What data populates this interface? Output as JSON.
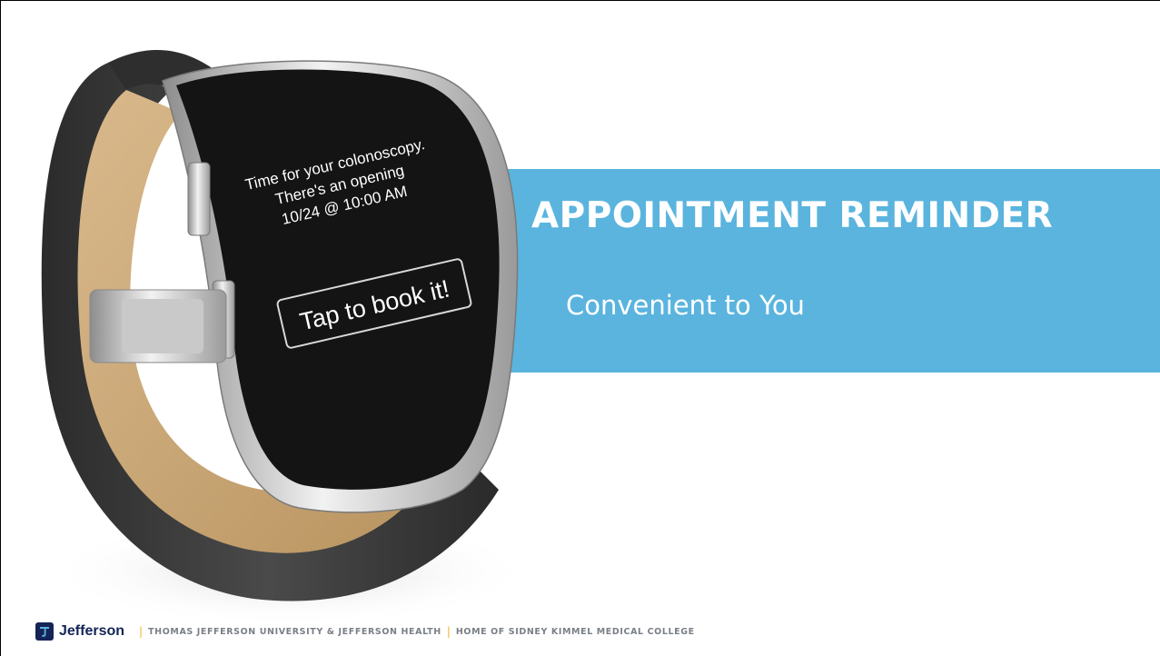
{
  "slide": {
    "title": "APPOINTMENT REMINDER",
    "subtitle": "Convenient to You"
  },
  "watch": {
    "message_line1": "Time for your colonoscopy.",
    "message_line2": "There's an opening",
    "message_line3": "10/24 @ 10:00 AM",
    "button_label": "Tap to book it!"
  },
  "footer": {
    "brand": "Jefferson",
    "org": "THOMAS JEFFERSON UNIVERSITY & JEFFERSON HEALTH",
    "tagline": "HOME OF SIDNEY KIMMEL MEDICAL COLLEGE"
  },
  "colors": {
    "banner": "#5ab4de",
    "brand_navy": "#152456",
    "separator": "#f2b01e"
  }
}
